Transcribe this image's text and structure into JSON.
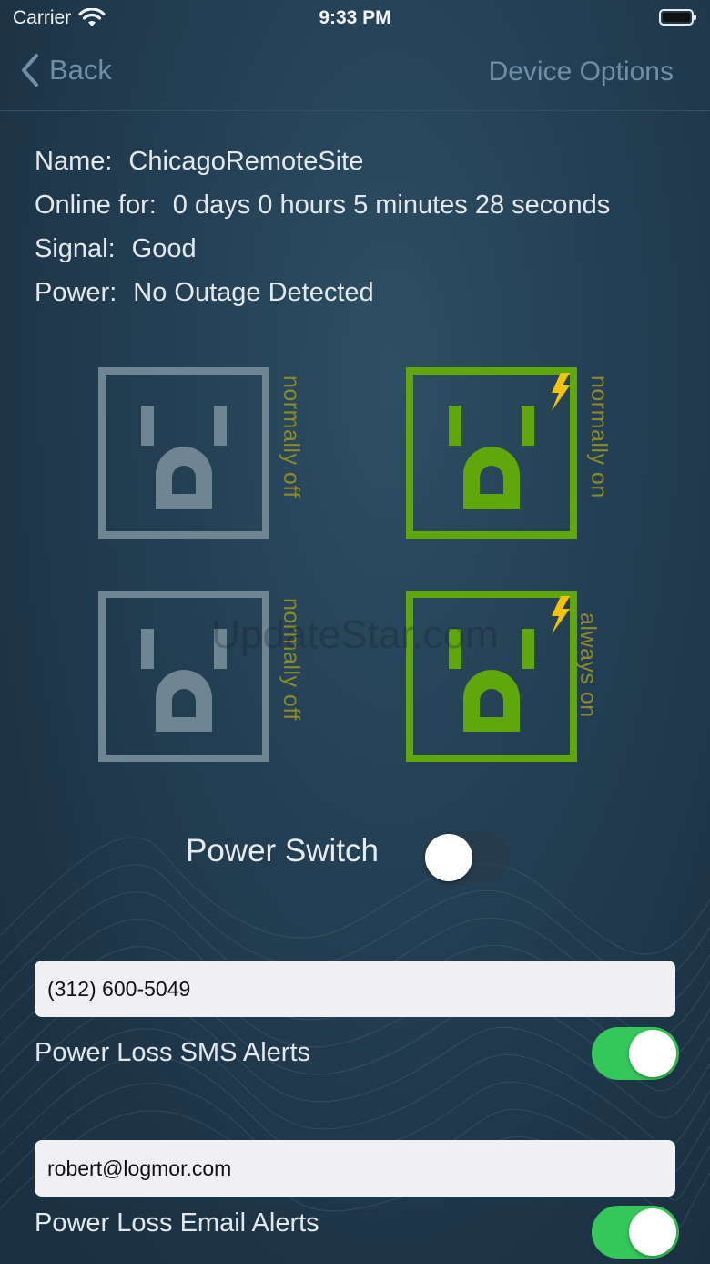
{
  "status_bar": {
    "carrier": "Carrier",
    "time": "9:33 PM",
    "icons": [
      "wifi-icon",
      "battery-icon"
    ]
  },
  "nav": {
    "back_label": "Back",
    "title": "Device Options"
  },
  "device": {
    "name_label": "Name:",
    "name_value": "ChicagoRemoteSite",
    "online_label": "Online for:",
    "online_value": "0 days 0 hours 5 minutes 28 seconds",
    "signal_label": "Signal:",
    "signal_value": "Good",
    "power_label": "Power:",
    "power_value": "No Outage Detected"
  },
  "outlets": [
    {
      "label": "normally off",
      "state": "off",
      "color": "#6f8591"
    },
    {
      "label": "normally on",
      "state": "on",
      "color": "#5fa70b"
    },
    {
      "label": "normally off",
      "state": "off",
      "color": "#6f8591"
    },
    {
      "label": "always on",
      "state": "on",
      "color": "#5fa70b"
    }
  ],
  "power_switch": {
    "label": "Power Switch",
    "on": false
  },
  "sms": {
    "value": "(312) 600-5049",
    "label": "Power Loss SMS Alerts",
    "enabled": true
  },
  "email": {
    "value": "robert@logmor.com",
    "label": "Power Loss Email Alerts",
    "enabled": true
  },
  "watermark": "UpdateStar.com",
  "colors": {
    "accent_green": "#34c759",
    "outlet_on": "#5fa70b",
    "outlet_off": "#6f8591",
    "bolt": "#f5c400",
    "nav_text": "#6f8fa8"
  }
}
